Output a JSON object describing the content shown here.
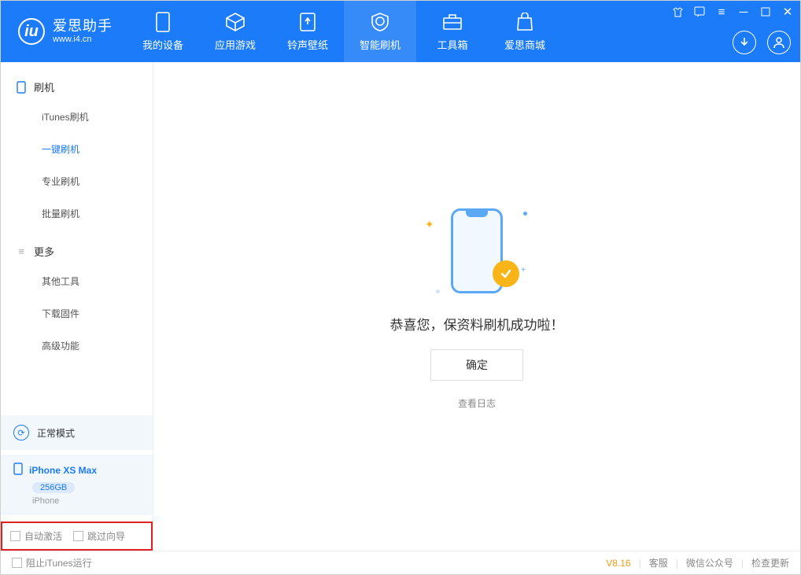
{
  "app": {
    "name_cn": "爱思助手",
    "name_en": "www.i4.cn"
  },
  "tabs": {
    "device": "我的设备",
    "apps": "应用游戏",
    "ringtone": "铃声壁纸",
    "flash": "智能刷机",
    "toolbox": "工具箱",
    "store": "爱思商城"
  },
  "sidebar": {
    "section_flash": "刷机",
    "items_flash": {
      "itunes": "iTunes刷机",
      "oneclick": "一键刷机",
      "pro": "专业刷机",
      "batch": "批量刷机"
    },
    "section_more": "更多",
    "items_more": {
      "other": "其他工具",
      "firmware": "下载固件",
      "advanced": "高级功能"
    },
    "mode": "正常模式",
    "device_name": "iPhone XS Max",
    "device_capacity": "256GB",
    "device_type": "iPhone",
    "opt_auto_activate": "自动激活",
    "opt_skip_guide": "跳过向导"
  },
  "main": {
    "success_msg": "恭喜您，保资料刷机成功啦！",
    "confirm": "确定",
    "view_log": "查看日志"
  },
  "footer": {
    "block_itunes": "阻止iTunes运行",
    "version": "V8.16",
    "support": "客服",
    "wechat": "微信公众号",
    "update": "检查更新"
  }
}
